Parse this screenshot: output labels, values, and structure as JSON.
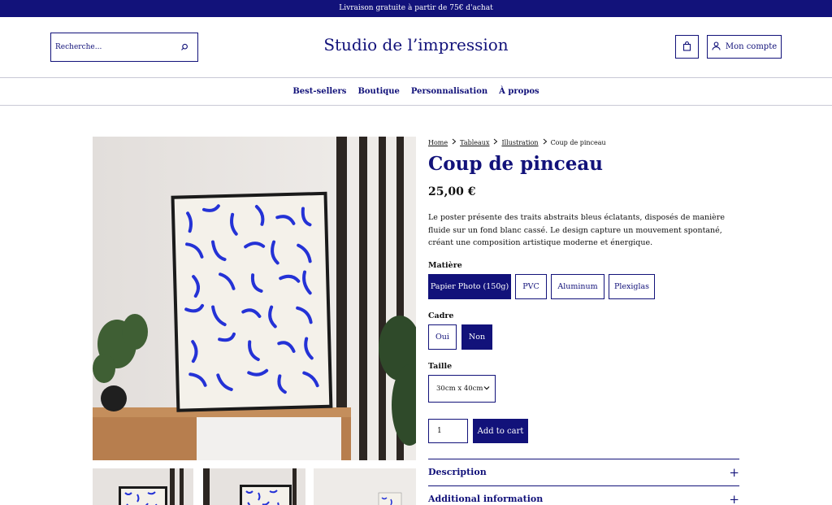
{
  "announcement": "Livraison gratuite à partir de 75€ d'achat",
  "header": {
    "search_placeholder": "Recherche...",
    "brand": "Studio de l’impression",
    "account_label": "Mon compte"
  },
  "nav": [
    "Best-sellers",
    "Boutique",
    "Personnalisation",
    "À propos"
  ],
  "breadcrumb": [
    "Home",
    "Tableaux",
    "Illustration",
    "Coup de pinceau"
  ],
  "product": {
    "title": "Coup de pinceau",
    "price": "25,00 €",
    "description": "Le poster présente des traits abstraits bleus éclatants, disposés de manière fluide sur un fond blanc cassé. Le design capture un mouvement spontané, créant une composition artistique moderne et énergique."
  },
  "options": {
    "material": {
      "label": "Matière",
      "values": [
        "Papier Photo (150g)",
        "PVC",
        "Aluminum",
        "Plexiglas"
      ],
      "selected": "Papier Photo (150g)"
    },
    "frame": {
      "label": "Cadre",
      "values": [
        "Oui",
        "Non"
      ],
      "selected": "Non"
    },
    "size": {
      "label": "Taille",
      "selected": "30cm x 40cm"
    }
  },
  "cart": {
    "quantity": "1",
    "add_label": "Add to cart"
  },
  "accordions": [
    "Description",
    "Additional information"
  ],
  "colors": {
    "brand": "#12127a",
    "artwork_blue": "#2432d6"
  }
}
